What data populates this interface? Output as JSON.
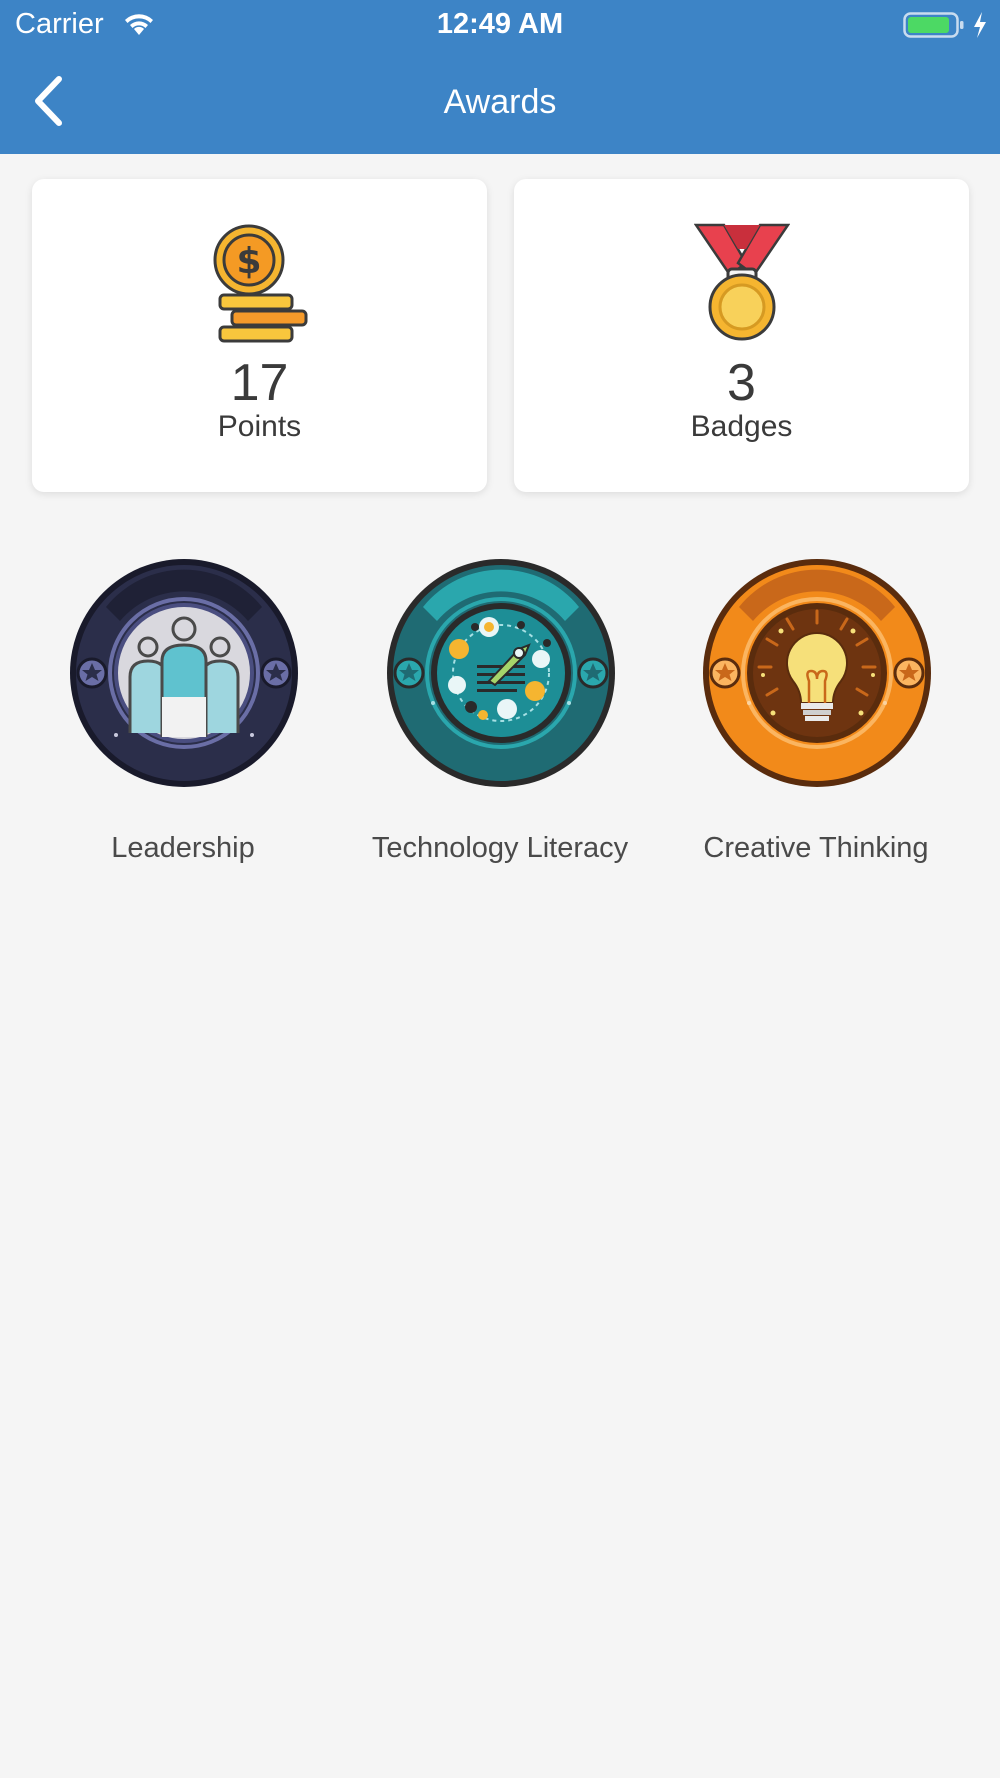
{
  "status_bar": {
    "carrier": "Carrier",
    "time": "12:49 AM"
  },
  "nav": {
    "title": "Awards",
    "back_icon": "chevron-left-icon"
  },
  "summary": {
    "points": {
      "value": "17",
      "label": "Points",
      "icon": "coins-icon"
    },
    "badges": {
      "value": "3",
      "label": "Badges",
      "icon": "medal-icon"
    }
  },
  "badges": [
    {
      "name": "Leadership",
      "icon": "leadership-badge-icon",
      "color": "#2b2e4a"
    },
    {
      "name": "Technology Literacy",
      "icon": "technology-literacy-badge-icon",
      "color": "#1f6b73"
    },
    {
      "name": "Creative Thinking",
      "icon": "creative-thinking-badge-icon",
      "color": "#d9761a"
    }
  ],
  "colors": {
    "header": "#3d84c6",
    "background": "#f5f5f5",
    "card": "#ffffff"
  }
}
